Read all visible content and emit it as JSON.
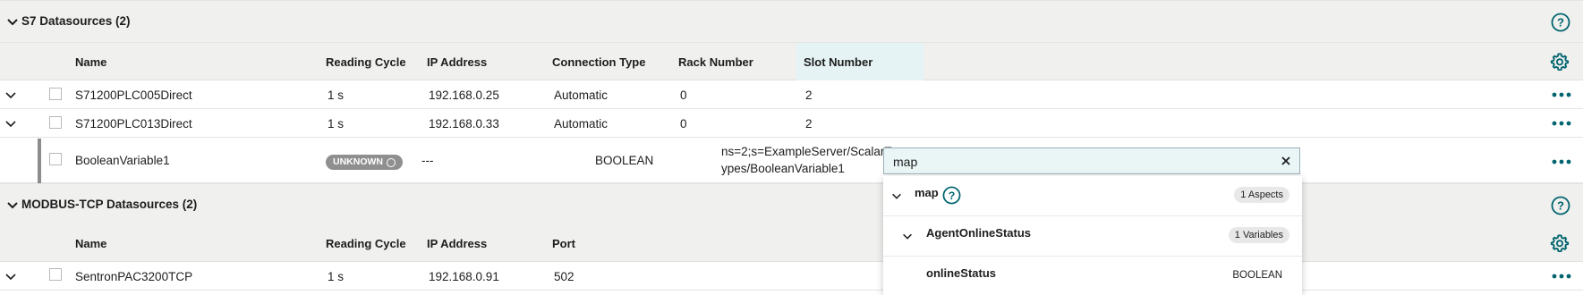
{
  "s7_section": {
    "title": "S7 Datasources (2)",
    "columns": [
      "Name",
      "Reading Cycle",
      "IP Address",
      "Connection Type",
      "Rack Number",
      "Slot Number"
    ],
    "rows": [
      {
        "name": "S71200PLC005Direct",
        "reading_cycle": "1 s",
        "ip": "192.168.0.25",
        "connection_type": "Automatic",
        "rack": "0",
        "slot": "2"
      },
      {
        "name": "S71200PLC013Direct",
        "reading_cycle": "1 s",
        "ip": "192.168.0.33",
        "connection_type": "Automatic",
        "rack": "0",
        "slot": "2"
      }
    ],
    "variable_row": {
      "name": "BooleanVariable1",
      "status_badge": "UNKNOWN",
      "dash": "---",
      "data_type": "BOOLEAN",
      "address_line1": "ns=2;s=ExampleServer/ScalarT",
      "address_line2": "ypes/BooleanVariable1"
    }
  },
  "modbus_section": {
    "title": "MODBUS-TCP Datasources (2)",
    "columns": [
      "Name",
      "Reading Cycle",
      "IP Address",
      "Port"
    ],
    "rows": [
      {
        "name": "SentronPAC3200TCP",
        "reading_cycle": "1 s",
        "ip": "192.168.0.91",
        "port": "502"
      }
    ]
  },
  "mapping_search": {
    "value": "map",
    "results": {
      "asset": {
        "label": "map",
        "count_badge": "1 Aspects"
      },
      "aspect": {
        "label": "AgentOnlineStatus",
        "count_badge": "1 Variables"
      },
      "variable": {
        "label": "onlineStatus",
        "type": "BOOLEAN"
      }
    }
  },
  "colors": {
    "accent": "#00646e",
    "header_bg": "#f0f0ee",
    "badge_grey": "#8f8f8f",
    "slot_highlight": "#e6f3f4"
  },
  "icons": [
    "chevron-down-icon",
    "help-icon",
    "gear-icon",
    "more-dots-icon",
    "close-icon",
    "checkbox-icon"
  ]
}
